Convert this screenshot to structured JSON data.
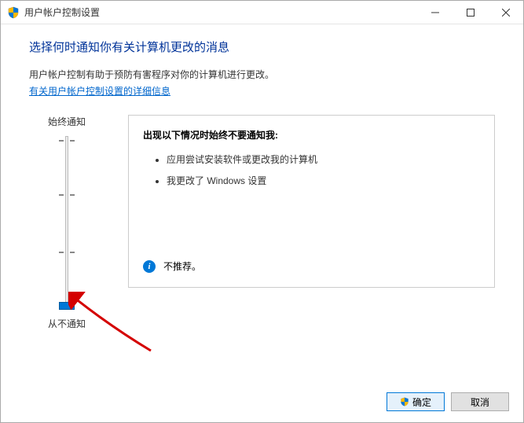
{
  "window": {
    "title": "用户帐户控制设置"
  },
  "header": {
    "page_title": "选择何时通知你有关计算机更改的消息",
    "description": "用户帐户控制有助于预防有害程序对你的计算机进行更改。",
    "link_text": "有关用户帐户控制设置的详细信息"
  },
  "slider": {
    "top_label": "始终通知",
    "bottom_label": "从不通知",
    "levels": 4,
    "current_level": 0
  },
  "info_panel": {
    "heading": "出现以下情况时始终不要通知我:",
    "bullets": [
      "应用尝试安装软件或更改我的计算机",
      "我更改了 Windows 设置"
    ],
    "recommendation": "不推荐。"
  },
  "buttons": {
    "ok": "确定",
    "cancel": "取消"
  }
}
